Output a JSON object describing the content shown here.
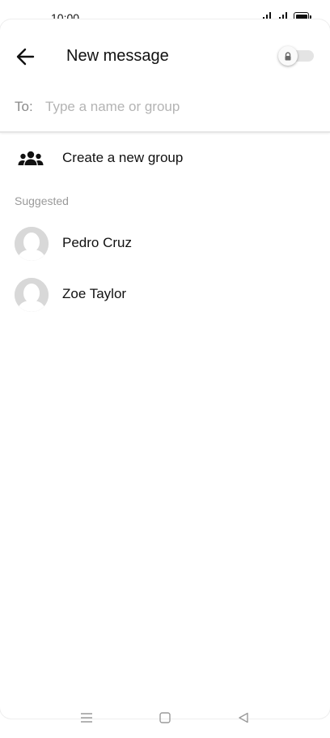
{
  "status_bar": {
    "time": "10:00"
  },
  "header": {
    "title": "New message"
  },
  "recipient": {
    "label": "To:",
    "placeholder": "Type a name or group",
    "value": ""
  },
  "actions": {
    "create_group_label": "Create a new group"
  },
  "suggested": {
    "section_label": "Suggested",
    "contacts": [
      {
        "name": "Pedro Cruz"
      },
      {
        "name": "Zoe Taylor"
      }
    ]
  },
  "icons": {
    "back": "back-arrow-icon",
    "lock": "lock-icon",
    "group": "group-icon",
    "avatar": "person-avatar-icon",
    "nav_menu": "menu-icon",
    "nav_home": "home-square-icon",
    "nav_back": "back-triangle-icon"
  },
  "colors": {
    "text": "#111111",
    "muted": "#8a8a8a",
    "placeholder": "#b4b4b4",
    "avatar_bg": "#d6d6d6"
  }
}
